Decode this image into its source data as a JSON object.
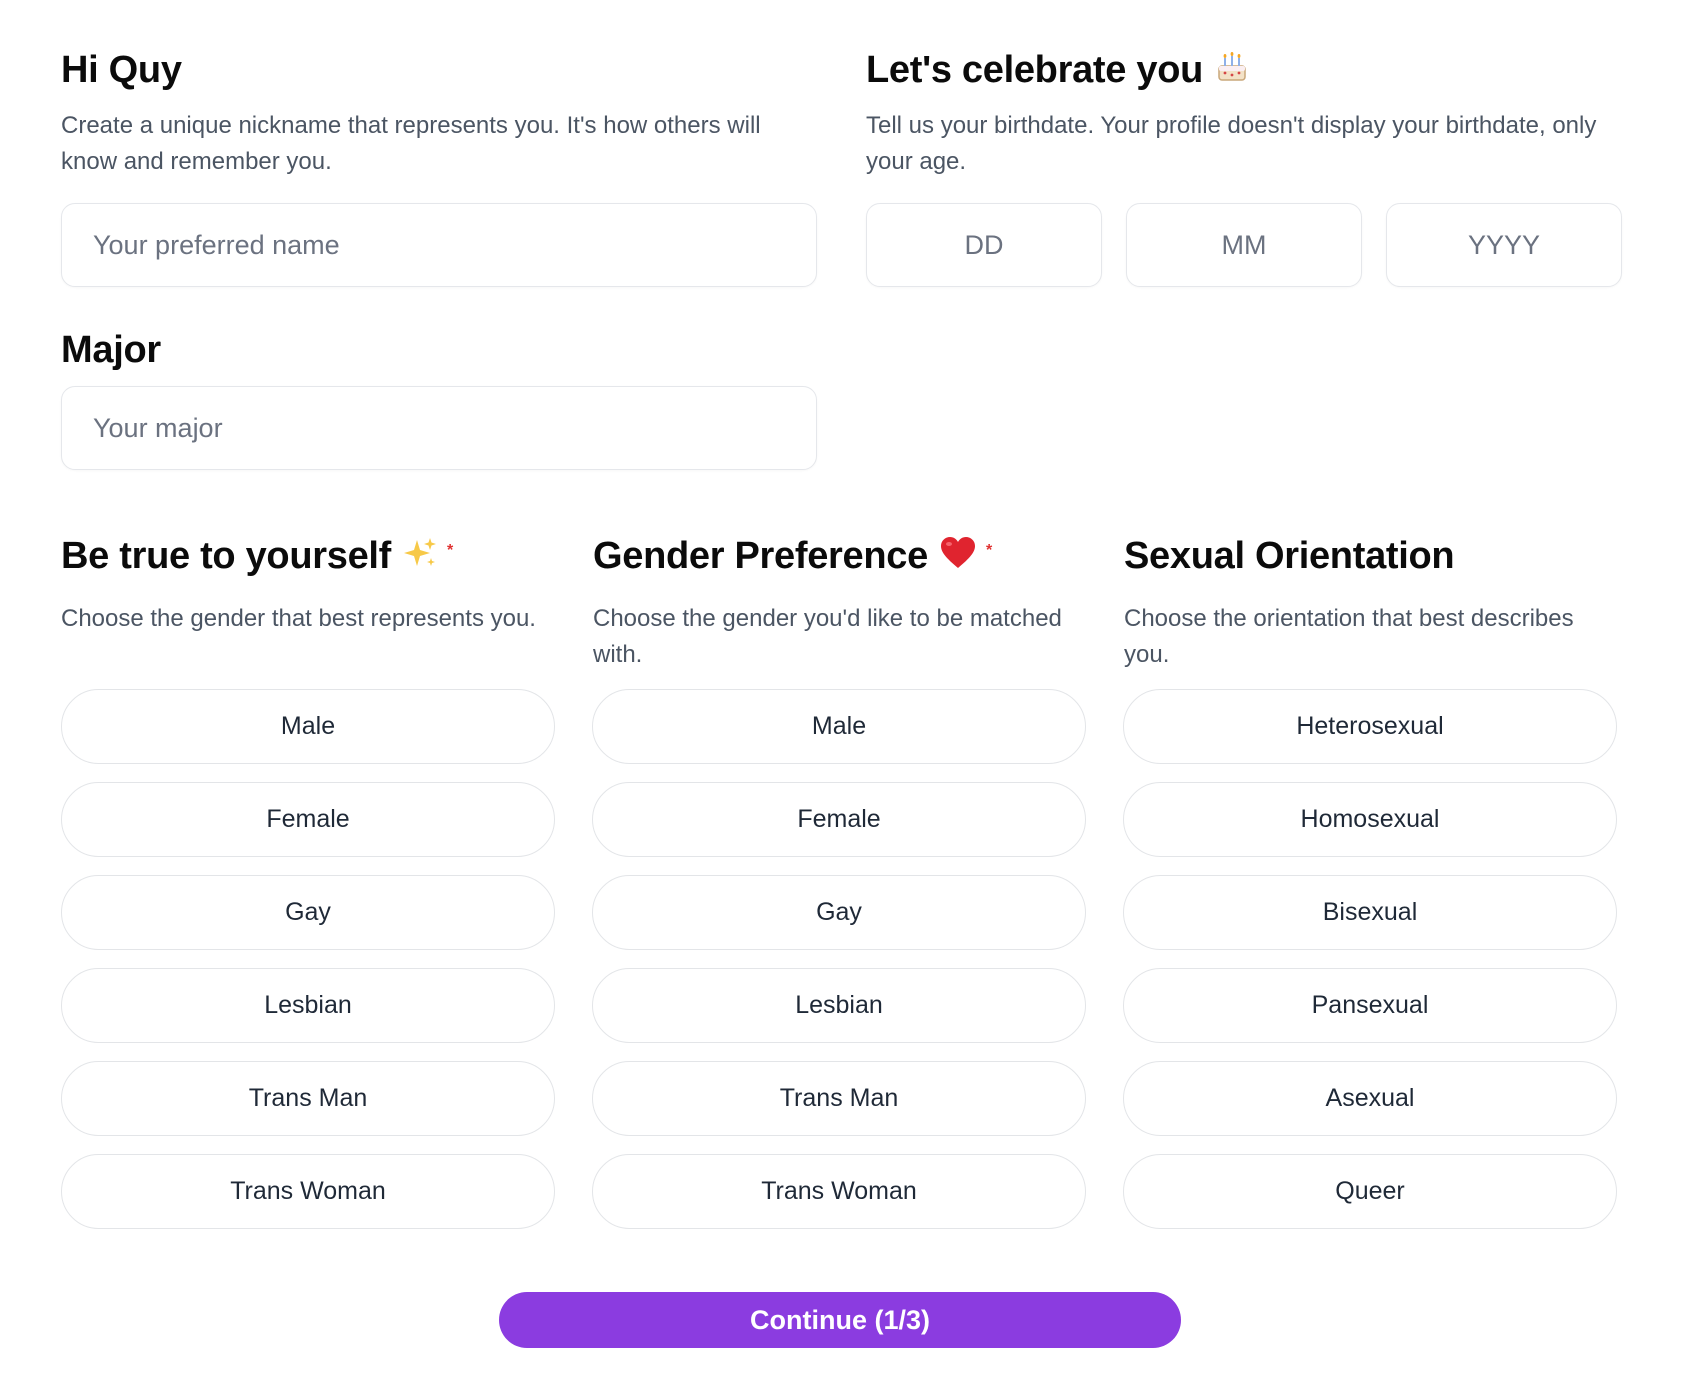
{
  "nickname": {
    "title": "Hi Quy",
    "description": "Create a unique nickname that represents you. It's how others will know and remember you.",
    "placeholder": "Your preferred name"
  },
  "birthday": {
    "title": "Let's celebrate you",
    "title_icon": "birthday-cake-icon",
    "description": "Tell us your birthdate. Your profile doesn't display your birthdate, only your age.",
    "day_placeholder": "DD",
    "month_placeholder": "MM",
    "year_placeholder": "YYYY"
  },
  "major": {
    "title": "Major",
    "placeholder": "Your major"
  },
  "gender": {
    "title": "Be true to yourself",
    "title_icon": "sparkles-icon",
    "required_mark": "*",
    "description": "Choose the gender that best represents you.",
    "options": [
      "Male",
      "Female",
      "Gay",
      "Lesbian",
      "Trans Man",
      "Trans Woman"
    ]
  },
  "preference": {
    "title": "Gender Preference",
    "title_icon": "red-heart-icon",
    "required_mark": "*",
    "description": "Choose the gender you'd like to be matched with.",
    "options": [
      "Male",
      "Female",
      "Gay",
      "Lesbian",
      "Trans Man",
      "Trans Woman"
    ]
  },
  "orientation": {
    "title": "Sexual Orientation",
    "description": "Choose the orientation that best describes you.",
    "options": [
      "Heterosexual",
      "Homosexual",
      "Bisexual",
      "Pansexual",
      "Asexual",
      "Queer"
    ]
  },
  "continue_label": "Continue (1/3)",
  "colors": {
    "accent": "#8b3ce0",
    "required": "#e03131",
    "border": "#e5e7eb",
    "muted_text": "#4b5563"
  }
}
